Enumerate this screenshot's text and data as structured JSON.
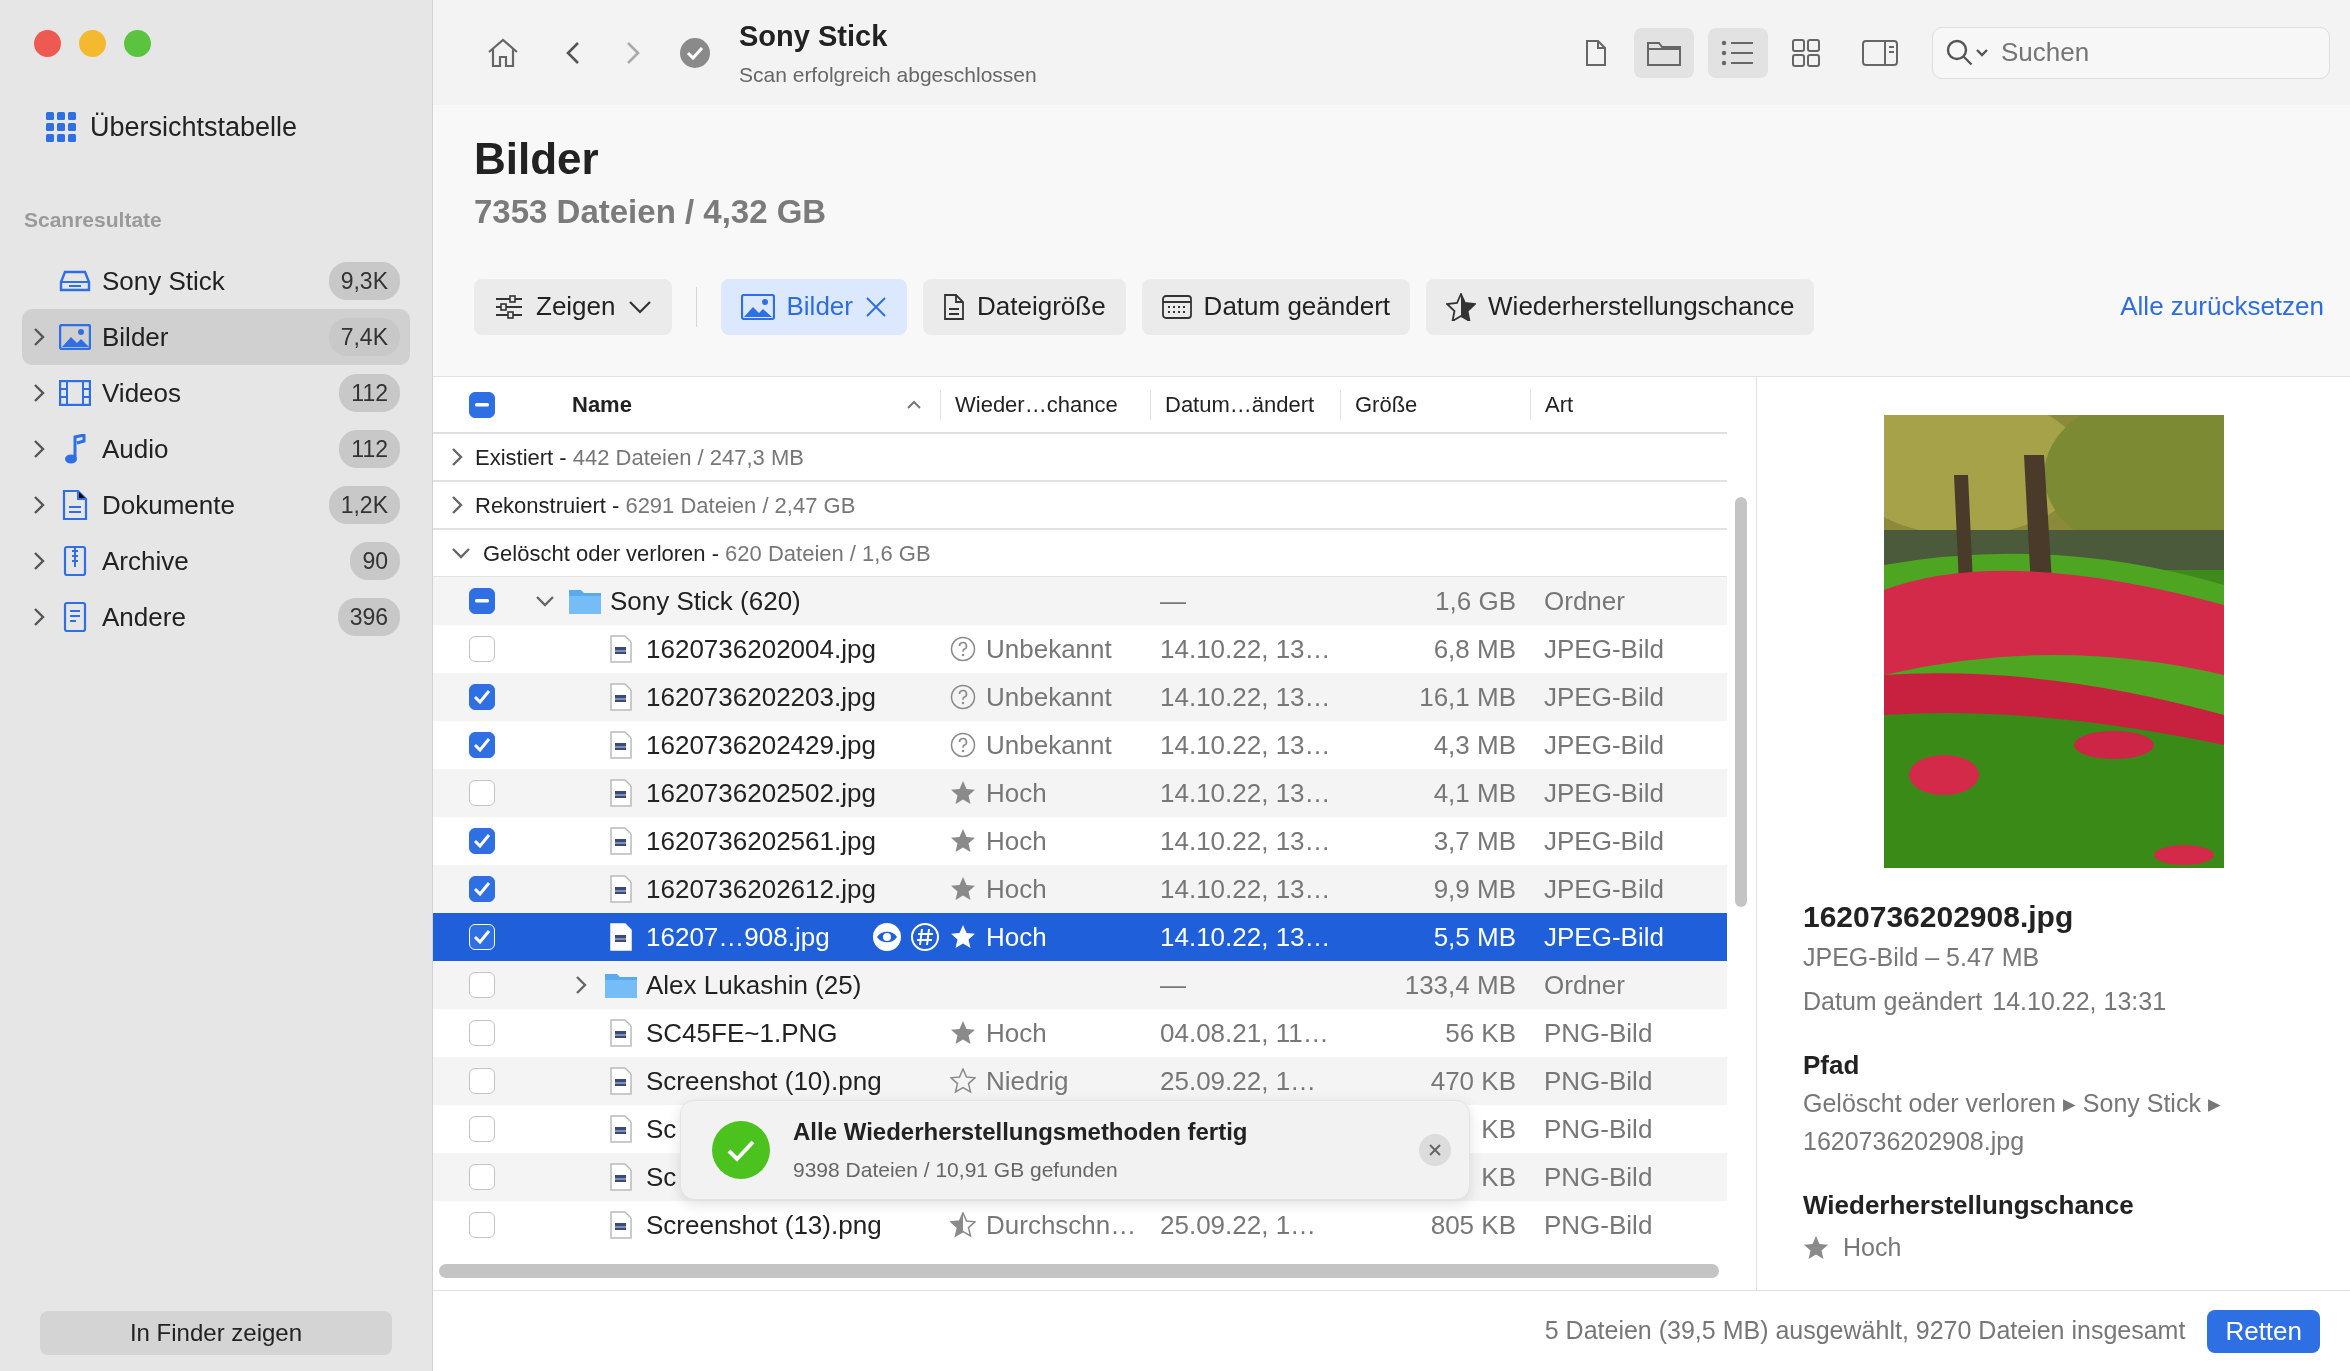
{
  "sidebar": {
    "overview": {
      "label": "Übersichtstabelle"
    },
    "section_title": "Scanresultate",
    "items": [
      {
        "label": "Sony Stick",
        "count": "9,3K",
        "kind": "drive",
        "expandable": false,
        "selected": false
      },
      {
        "label": "Bilder",
        "count": "7,4K",
        "kind": "images",
        "expandable": true,
        "selected": true
      },
      {
        "label": "Videos",
        "count": "112",
        "kind": "videos",
        "expandable": true,
        "selected": false
      },
      {
        "label": "Audio",
        "count": "112",
        "kind": "audio",
        "expandable": true,
        "selected": false
      },
      {
        "label": "Dokumente",
        "count": "1,2K",
        "kind": "documents",
        "expandable": true,
        "selected": false
      },
      {
        "label": "Archive",
        "count": "90",
        "kind": "archives",
        "expandable": true,
        "selected": false
      },
      {
        "label": "Andere",
        "count": "396",
        "kind": "other",
        "expandable": true,
        "selected": false
      }
    ],
    "finder_button": "In Finder zeigen"
  },
  "toolbar": {
    "title": "Sony Stick",
    "subtitle": "Scan erfolgreich abgeschlossen",
    "search": {
      "placeholder": "Suchen"
    },
    "view_buttons": [
      {
        "kind": "file",
        "selected": false
      },
      {
        "kind": "folder",
        "selected": true
      },
      {
        "kind": "list",
        "selected": true
      },
      {
        "kind": "grid",
        "selected": false
      },
      {
        "kind": "sidebar",
        "selected": false
      }
    ]
  },
  "header": {
    "title": "Bilder",
    "summary": "7353 Dateien / 4,32 GB"
  },
  "filters": [
    {
      "kind": "show",
      "label": "Zeigen",
      "selected": false
    },
    {
      "kind": "images",
      "label": "Bilder",
      "selected": true
    },
    {
      "kind": "size",
      "label": "Dateigröße",
      "selected": false
    },
    {
      "kind": "date",
      "label": "Datum geändert",
      "selected": false
    },
    {
      "kind": "chance",
      "label": "Wiederherstellungschance",
      "selected": false
    }
  ],
  "reset_link": "Alle zurücksetzen",
  "table": {
    "select_all": {
      "indeterminate": true
    },
    "columns": [
      "Name",
      "Wieder…chance",
      "Datum…ändert",
      "Größe",
      "Art"
    ],
    "groups": [
      {
        "label": "Existiert -",
        "summary": "442 Dateien / 247,3 MB",
        "expanded": false
      },
      {
        "label": "Rekonstruiert -",
        "summary": "6291 Dateien / 2,47 GB",
        "expanded": false
      },
      {
        "label": "Gelöscht oder verloren -",
        "summary": "620 Dateien / 1,6 GB",
        "expanded": true,
        "children": [
          {
            "kind": "folder",
            "name": "Sony Stick (620)",
            "expanded": true,
            "indeterminate": true,
            "selected": false,
            "date": "—",
            "size": "1,6 GB",
            "type": "Ordner",
            "children": [
              {
                "kind": "file",
                "name": "1620736202004.jpg",
                "checked": false,
                "selected": false,
                "chance": {
                  "kind": "unknown",
                  "label": "Unbekannt"
                },
                "date": "14.10.22, 13…",
                "size": "6,8 MB",
                "type": "JPEG-Bild"
              },
              {
                "kind": "file",
                "name": "1620736202203.jpg",
                "checked": true,
                "selected": false,
                "chance": {
                  "kind": "unknown",
                  "label": "Unbekannt"
                },
                "date": "14.10.22, 13…",
                "size": "16,1 MB",
                "type": "JPEG-Bild"
              },
              {
                "kind": "file",
                "name": "1620736202429.jpg",
                "checked": true,
                "selected": false,
                "chance": {
                  "kind": "unknown",
                  "label": "Unbekannt"
                },
                "date": "14.10.22, 13…",
                "size": "4,3 MB",
                "type": "JPEG-Bild"
              },
              {
                "kind": "file",
                "name": "1620736202502.jpg",
                "checked": false,
                "selected": false,
                "chance": {
                  "kind": "high",
                  "label": "Hoch"
                },
                "date": "14.10.22, 13…",
                "size": "4,1 MB",
                "type": "JPEG-Bild"
              },
              {
                "kind": "file",
                "name": "1620736202561.jpg",
                "checked": true,
                "selected": false,
                "chance": {
                  "kind": "high",
                  "label": "Hoch"
                },
                "date": "14.10.22, 13…",
                "size": "3,7 MB",
                "type": "JPEG-Bild"
              },
              {
                "kind": "file",
                "name": "1620736202612.jpg",
                "checked": true,
                "selected": false,
                "chance": {
                  "kind": "high",
                  "label": "Hoch"
                },
                "date": "14.10.22, 13…",
                "size": "9,9 MB",
                "type": "JPEG-Bild"
              },
              {
                "kind": "file",
                "name": "16207…908.jpg",
                "checked": true,
                "selected": true,
                "chance": {
                  "kind": "high",
                  "label": "Hoch"
                },
                "date": "14.10.22, 13…",
                "size": "5,5 MB",
                "type": "JPEG-Bild"
              },
              {
                "kind": "folder",
                "name": "Alex Lukashin (25)",
                "expanded": false,
                "checked": false,
                "selected": false,
                "date": "—",
                "size": "133,4 MB",
                "type": "Ordner"
              },
              {
                "kind": "file",
                "name": "SC45FE~1.PNG",
                "checked": false,
                "selected": false,
                "chance": {
                  "kind": "high",
                  "label": "Hoch"
                },
                "date": "04.08.21, 11…",
                "size": "56 KB",
                "type": "PNG-Bild"
              },
              {
                "kind": "file",
                "name": "Screenshot (10).png",
                "checked": false,
                "selected": false,
                "chance": {
                  "kind": "low",
                  "label": "Niedrig"
                },
                "date": "25.09.22, 1…",
                "size": "470 KB",
                "type": "PNG-Bild"
              },
              {
                "kind": "file",
                "name": "Sc",
                "checked": false,
                "selected": false,
                "size": "KB",
                "type": "PNG-Bild"
              },
              {
                "kind": "file",
                "name": "Sc",
                "checked": false,
                "selected": false,
                "size": "KB",
                "type": "PNG-Bild"
              },
              {
                "kind": "file",
                "name": "Screenshot (13).png",
                "checked": false,
                "selected": false,
                "chance": {
                  "kind": "average",
                  "label": "Durchschn…"
                },
                "date": "25.09.22, 1…",
                "size": "805 KB",
                "type": "PNG-Bild"
              }
            ]
          }
        ]
      }
    ]
  },
  "toast": {
    "title": "Alle Wiederherstellungsmethoden fertig",
    "message": "9398 Dateien / 10,91 GB gefunden"
  },
  "preview": {
    "filename": "1620736202908.jpg",
    "info": "JPEG-Bild – 5.47 MB",
    "date_label": "Datum geändert",
    "date": "14.10.22, 13:31",
    "path_title": "Pfad",
    "path": "Gelöscht oder verloren ▸ Sony Stick ▸ 1620736202908.jpg",
    "chance_title": "Wiederherstellungschance",
    "chance": {
      "kind": "high",
      "label": "Hoch"
    }
  },
  "footer": {
    "status": "5 Dateien (39,5 MB) ausgewählt, 9270 Dateien insgesamt",
    "button": "Retten"
  }
}
